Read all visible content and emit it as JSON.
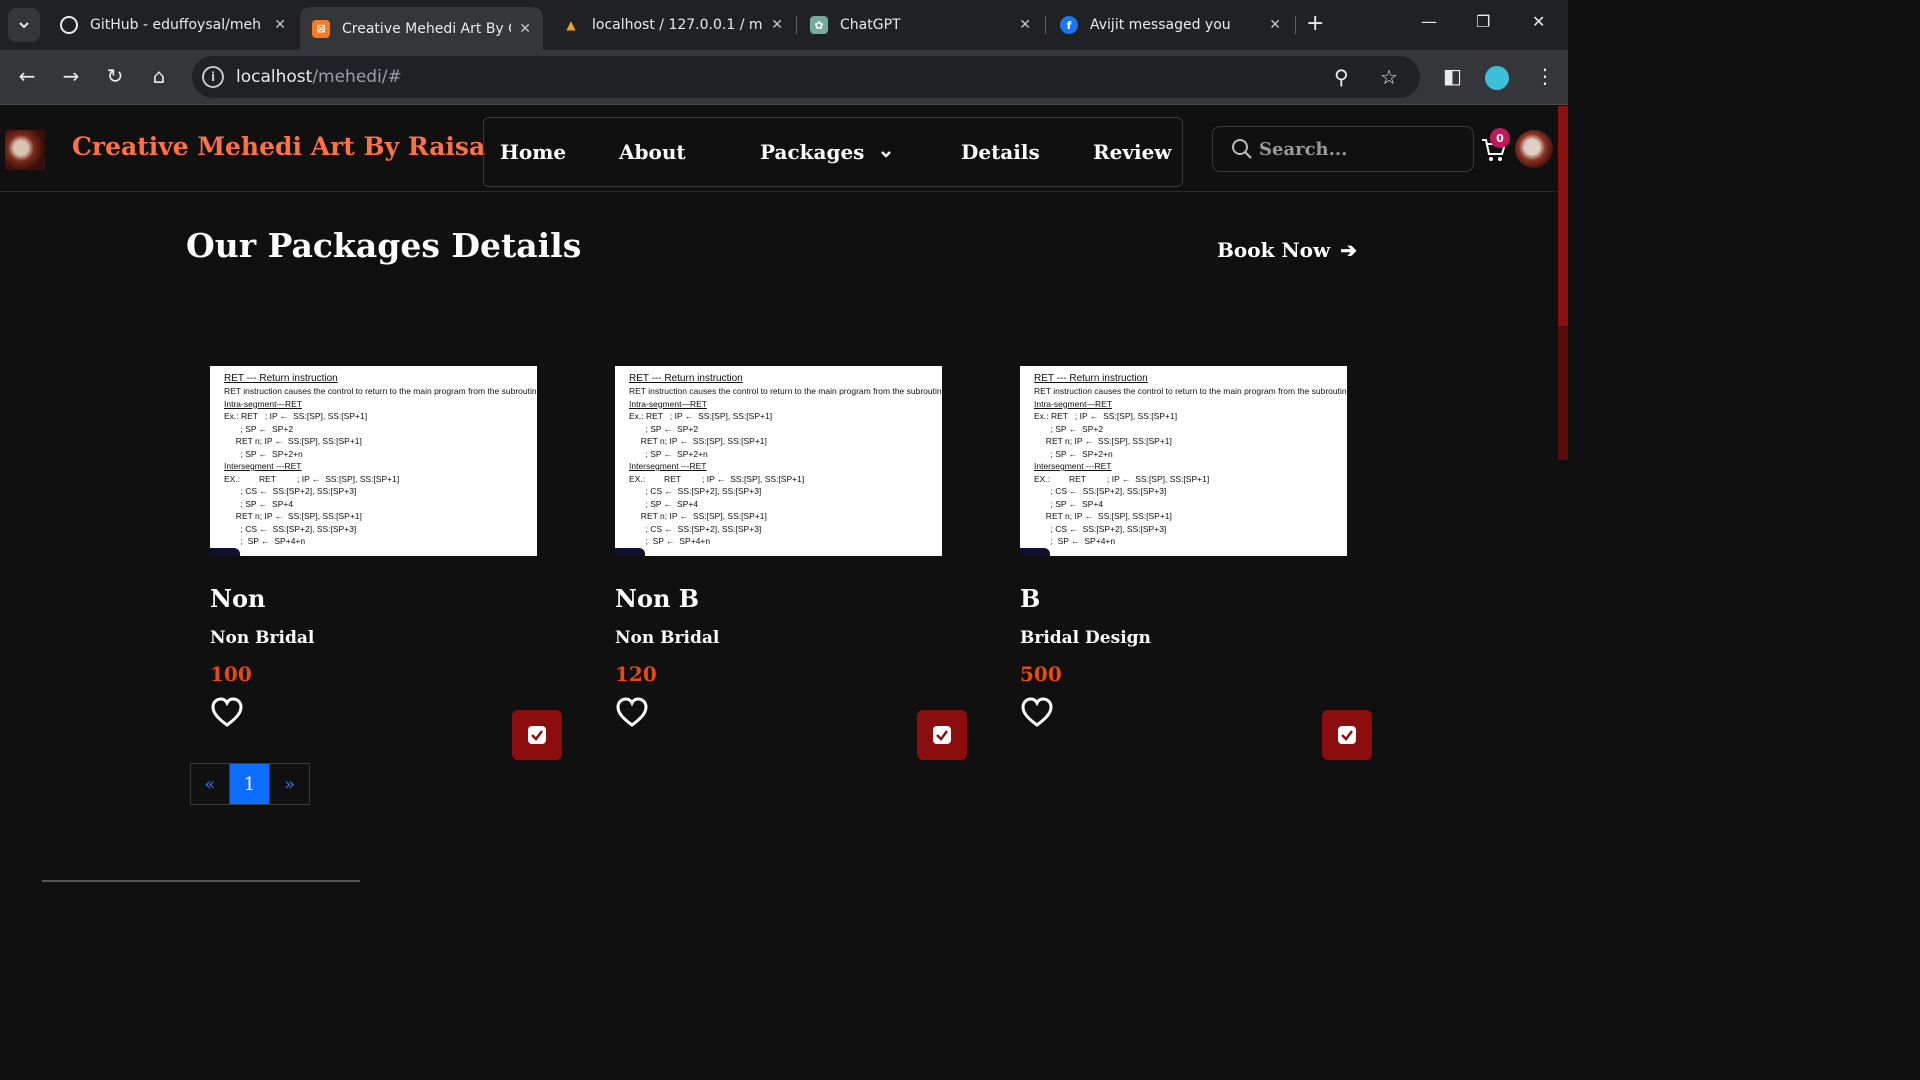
{
  "browser": {
    "tabs": [
      {
        "title": "GitHub - eduffoysal/meh",
        "favicon": "github-icon",
        "active": false
      },
      {
        "title": "Creative Mehedi Art By C",
        "favicon": "xampp-icon",
        "active": true
      },
      {
        "title": "localhost / 127.0.0.1 / me",
        "favicon": "phpmyadmin-icon",
        "active": false
      },
      {
        "title": "ChatGPT",
        "favicon": "chatgpt-icon",
        "active": false
      },
      {
        "title": "Avijit messaged you",
        "favicon": "facebook-icon",
        "active": false
      }
    ],
    "url_host": "localhost",
    "url_path": "/mehedi/#"
  },
  "navbar": {
    "brand": "Creative Mehedi Art By Raisa",
    "menu": [
      "Home",
      "About",
      "Packages",
      "Details",
      "Review"
    ],
    "search_placeholder": "Search...",
    "cart_count": "0"
  },
  "section": {
    "title": "Our Packages Details",
    "book_now": "Book Now"
  },
  "thumbnail_text": [
    {
      "text": "RET --- Return instruction",
      "style": "h"
    },
    {
      "text": "RET instruction causes the control to return to the main program from the subroutine.",
      "style": ""
    },
    {
      "text": "Intra-segment—RET",
      "style": "u"
    },
    {
      "text": "Ex.: RET   ; IP ←  SS:[SP], SS:[SP+1]",
      "style": ""
    },
    {
      "text": "       ; SP ←  SP+2",
      "style": ""
    },
    {
      "text": "     RET n; IP ←  SS:[SP], SS:[SP+1]",
      "style": ""
    },
    {
      "text": "       ; SP ←  SP+2+n",
      "style": ""
    },
    {
      "text": "Intersegment ---RET",
      "style": "u"
    },
    {
      "text": "EX.:        RET         ; IP ←  SS:[SP], SS:[SP+1]",
      "style": ""
    },
    {
      "text": "       ; CS ←  SS:[SP+2], SS:[SP+3]",
      "style": ""
    },
    {
      "text": "       ; SP ←  SP+4",
      "style": ""
    },
    {
      "text": "     RET n; IP ←  SS:[SP], SS:[SP+1]",
      "style": ""
    },
    {
      "text": "       ; CS ←  SS:[SP+2], SS:[SP+3]",
      "style": ""
    },
    {
      "text": "       ;  SP ←  SP+4+n",
      "style": ""
    }
  ],
  "packages": [
    {
      "name": "Non",
      "category": "Non Bridal",
      "price": "100"
    },
    {
      "name": "Non B",
      "category": "Non Bridal",
      "price": "120"
    },
    {
      "name": "B",
      "category": "Bridal Design",
      "price": "500"
    }
  ],
  "pagination": {
    "prev": "«",
    "current": "1",
    "next": "»"
  },
  "colors": {
    "brand": "#ff7043",
    "price": "#e8490f",
    "cart_button": "#8b0d0d",
    "page_active": "#0d6efd"
  }
}
